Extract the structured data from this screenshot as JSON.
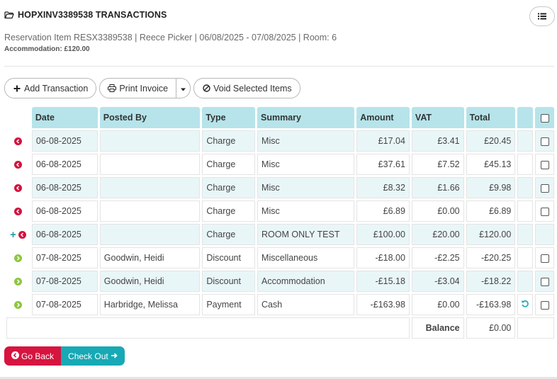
{
  "header": {
    "title": "HOPXINV3389538 TRANSACTIONS",
    "subtitle": "Reservation Item RESX3389538 | Reece Picker | 06/08/2025 - 07/08/2025 | Room: 6",
    "accommodation": "Accommodation: £120.00"
  },
  "toolbar": {
    "add_label": "Add Transaction",
    "print_label": "Print Invoice",
    "void_label": "Void Selected Items"
  },
  "table": {
    "columns": [
      "Date",
      "Posted By",
      "Type",
      "Summary",
      "Amount",
      "VAT",
      "Total"
    ],
    "rows": [
      {
        "action": "red",
        "plus": false,
        "date": "06-08-2025",
        "posted_by": "",
        "type": "Charge",
        "summary": "Misc",
        "amount": "£17.04",
        "vat": "£3.41",
        "total": "£20.45",
        "refresh": false,
        "checkbox": true
      },
      {
        "action": "red",
        "plus": false,
        "date": "06-08-2025",
        "posted_by": "",
        "type": "Charge",
        "summary": "Misc",
        "amount": "£37.61",
        "vat": "£7.52",
        "total": "£45.13",
        "refresh": false,
        "checkbox": true
      },
      {
        "action": "red",
        "plus": false,
        "date": "06-08-2025",
        "posted_by": "",
        "type": "Charge",
        "summary": "Misc",
        "amount": "£8.32",
        "vat": "£1.66",
        "total": "£9.98",
        "refresh": false,
        "checkbox": true
      },
      {
        "action": "red",
        "plus": false,
        "date": "06-08-2025",
        "posted_by": "",
        "type": "Charge",
        "summary": "Misc",
        "amount": "£6.89",
        "vat": "£0.00",
        "total": "£6.89",
        "refresh": false,
        "checkbox": true
      },
      {
        "action": "red",
        "plus": true,
        "date": "06-08-2025",
        "posted_by": "",
        "type": "Charge",
        "summary": "ROOM ONLY TEST",
        "amount": "£100.00",
        "vat": "£20.00",
        "total": "£120.00",
        "refresh": false,
        "checkbox": false
      },
      {
        "action": "green",
        "plus": false,
        "date": "07-08-2025",
        "posted_by": "Goodwin, Heidi",
        "type": "Discount",
        "summary": "Miscellaneous",
        "amount": "-£18.00",
        "vat": "-£2.25",
        "total": "-£20.25",
        "refresh": false,
        "checkbox": true
      },
      {
        "action": "green",
        "plus": false,
        "date": "07-08-2025",
        "posted_by": "Goodwin, Heidi",
        "type": "Discount",
        "summary": "Accommodation",
        "amount": "-£15.18",
        "vat": "-£3.04",
        "total": "-£18.22",
        "refresh": false,
        "checkbox": true
      },
      {
        "action": "green",
        "plus": false,
        "date": "07-08-2025",
        "posted_by": "Harbridge, Melissa",
        "type": "Payment",
        "summary": "Cash",
        "amount": "-£163.98",
        "vat": "£0.00",
        "total": "-£163.98",
        "refresh": true,
        "checkbox": true
      }
    ],
    "balance_label": "Balance",
    "balance_value": "£0.00"
  },
  "footer": {
    "back_label": "Go Back",
    "checkout_label": "Check Out"
  },
  "colors": {
    "header_bg": "#b6e4ea",
    "stripe_bg": "#e9f6f8",
    "red_accent": "#d4123e",
    "green_accent": "#8ec63f",
    "teal_accent": "#17a9b5"
  }
}
